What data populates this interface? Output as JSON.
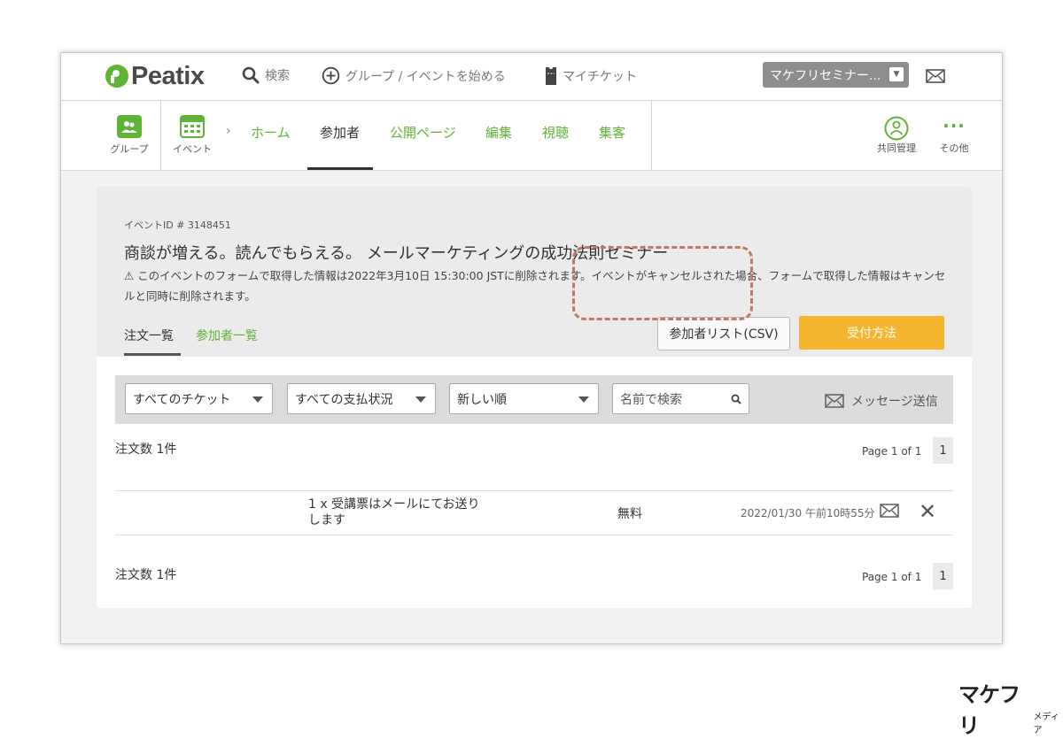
{
  "topnav": {
    "logo": "Peatix",
    "search_label": "検索",
    "start_label": "グループ / イベントを始める",
    "tickets_label": "マイチケット",
    "account_label": "マケフリセミナー..."
  },
  "subnav": {
    "group_label": "グループ",
    "event_label": "イベント",
    "tabs": [
      "ホーム",
      "参加者",
      "公開ページ",
      "編集",
      "視聴",
      "集客"
    ],
    "active_tab": "参加者",
    "cohost_label": "共同管理",
    "more_label": "その他"
  },
  "event": {
    "id_label": "イベントID # 3148451",
    "title": "商談が増える。読んでもらえる。 メールマーケティングの成功法則セミナー",
    "warning": "⚠ このイベントのフォームで取得した情報は2022年3月10日 15:30:00 JSTに削除されます。イベントがキャンセルされた場合、フォームで取得した情報はキャンセルと同時に削除されます。"
  },
  "subtabs": {
    "orders": "注文一覧",
    "attendees": "参加者一覧"
  },
  "buttons": {
    "csv": "参加者リスト(CSV)",
    "accept": "受付方法"
  },
  "filters": {
    "ticket": "すべてのチケット",
    "payment": "すべての支払状況",
    "sort": "新しい順",
    "search_placeholder": "名前で検索",
    "message": "メッセージ送信"
  },
  "orders": {
    "count_label": "注文数 1件",
    "page_label": "Page 1 of 1",
    "page_num": "1",
    "rows": [
      {
        "ticket": "1 x 受講票はメールにてお送りします",
        "price": "無料",
        "date": "2022/01/30 午前10時55分"
      }
    ]
  },
  "brand": {
    "main": "マケフリ",
    "sub": "メディア"
  }
}
